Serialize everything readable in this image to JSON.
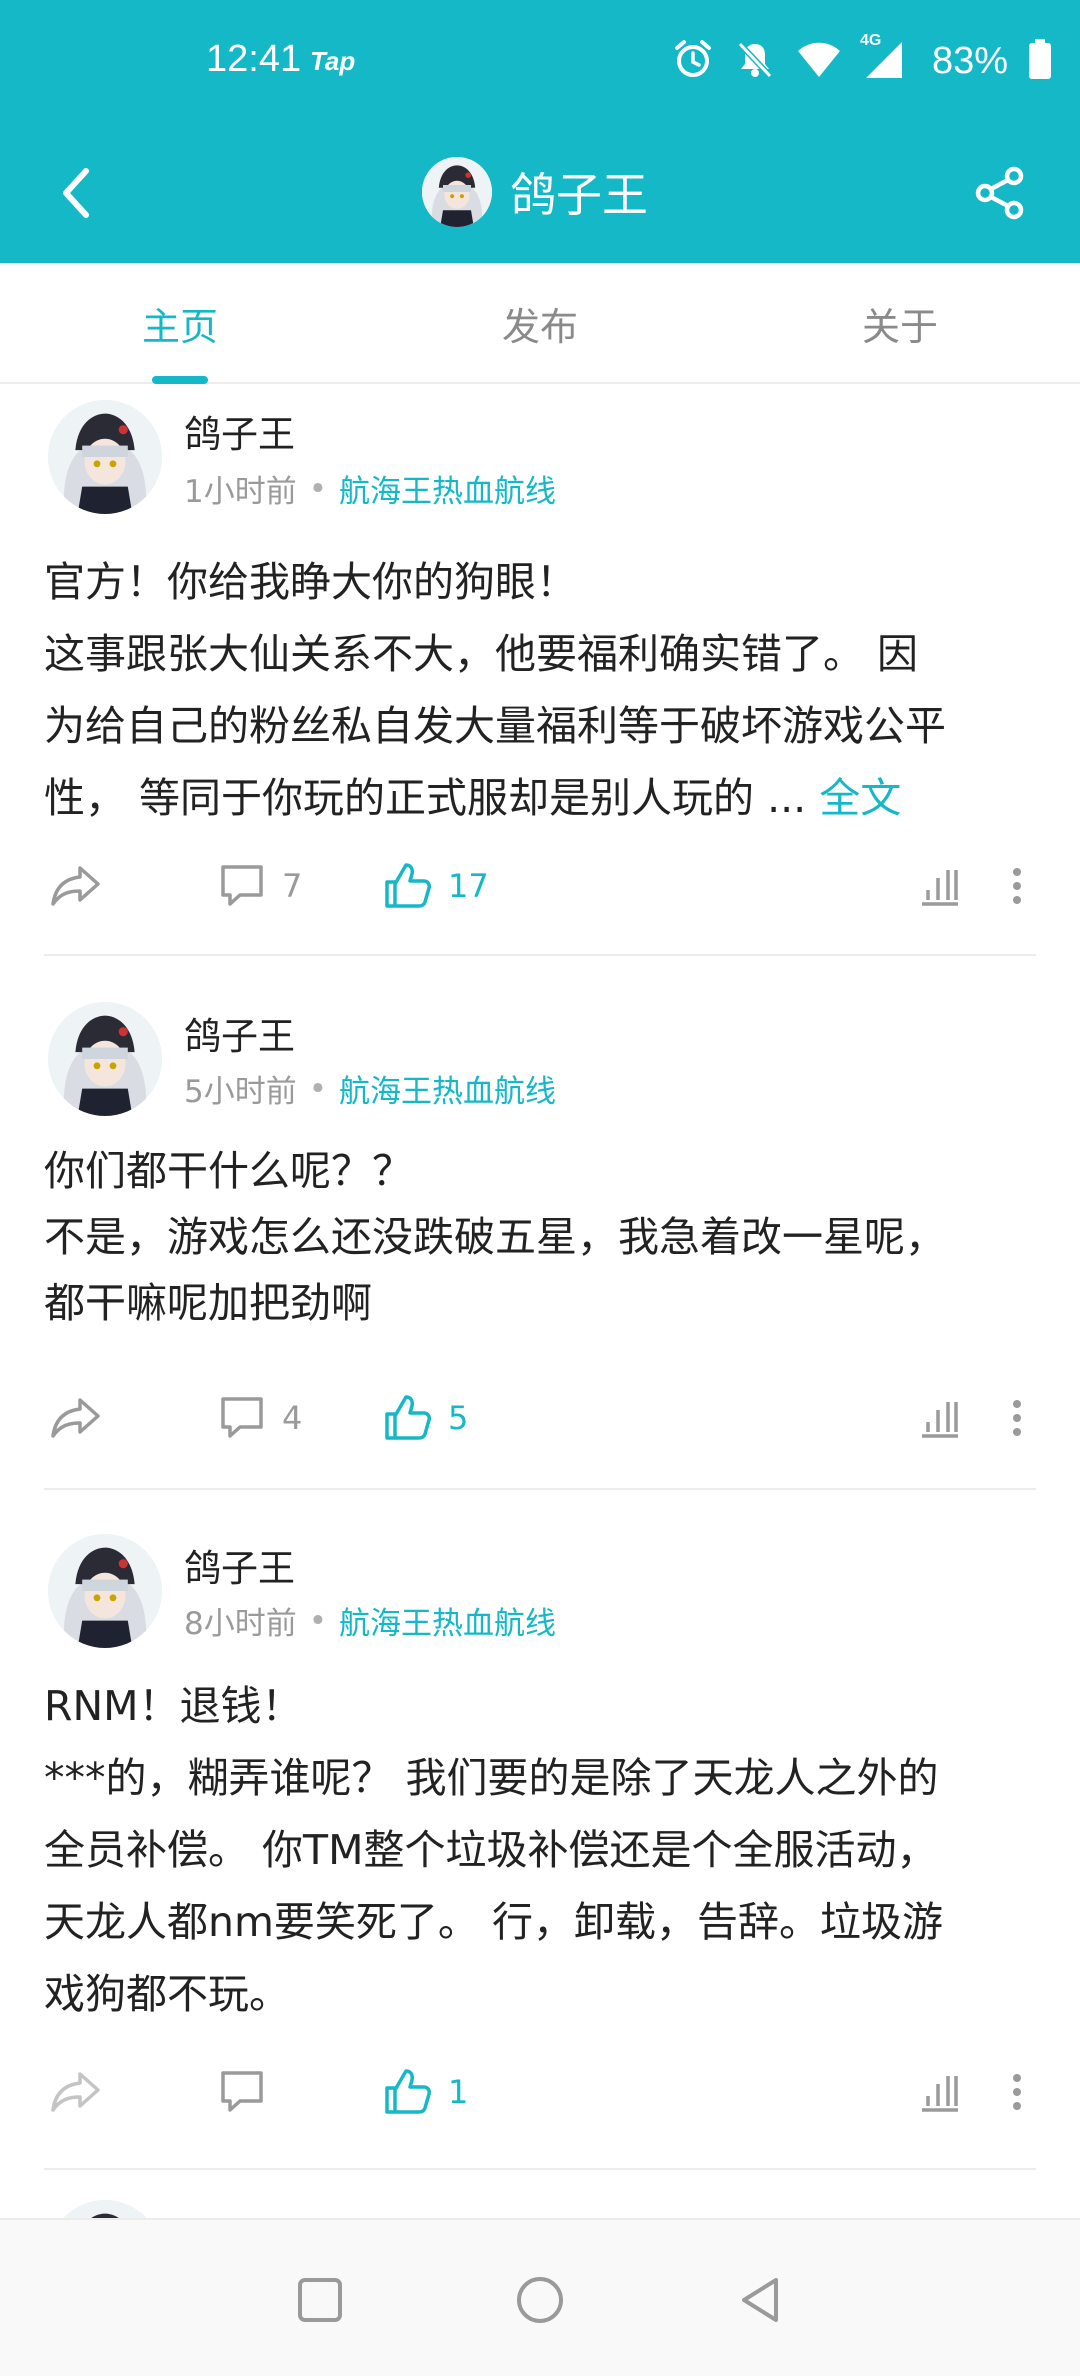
{
  "status_bar": {
    "time": "12:41",
    "app_tag": "Tap",
    "network": "4G",
    "battery": "83%"
  },
  "header": {
    "title": "鸽子王"
  },
  "tabs": [
    {
      "label": "主页",
      "active": true
    },
    {
      "label": "发布",
      "active": false
    },
    {
      "label": "关于",
      "active": false
    }
  ],
  "posts": [
    {
      "author": "鸽子王",
      "time": "1小时前",
      "topic": "航海王热血航线",
      "lines": [
        "官方！你给我睁大你的狗眼！",
        "这事跟张大仙关系不大，他要福利确实错了。 因",
        "为给自己的粉丝私自发大量福利等于破坏游戏公平",
        "性， 等同于你玩的正式服却是别人玩的 ... "
      ],
      "more": "全文",
      "comments": "7",
      "likes": "17"
    },
    {
      "author": "鸽子王",
      "time": "5小时前",
      "topic": "航海王热血航线",
      "lines": [
        "你们都干什么呢？？",
        "不是，游戏怎么还没跌破五星，我急着改一星呢，",
        "都干嘛呢加把劲啊"
      ],
      "comments": "4",
      "likes": "5"
    },
    {
      "author": "鸽子王",
      "time": "8小时前",
      "topic": "航海王热血航线",
      "lines": [
        "RNM！退钱！",
        "***的，糊弄谁呢？ 我们要的是除了天龙人之外的",
        "全员补偿。 你TM整个垃圾补偿还是个全服活动，",
        "天龙人都nm要笑死了。 行，卸载，告辞。垃圾游",
        "戏狗都不玩。"
      ],
      "comments": "",
      "likes": "1"
    }
  ],
  "colors": {
    "accent": "#15b8c6",
    "muted": "#9a9a9a",
    "text": "#222222"
  }
}
